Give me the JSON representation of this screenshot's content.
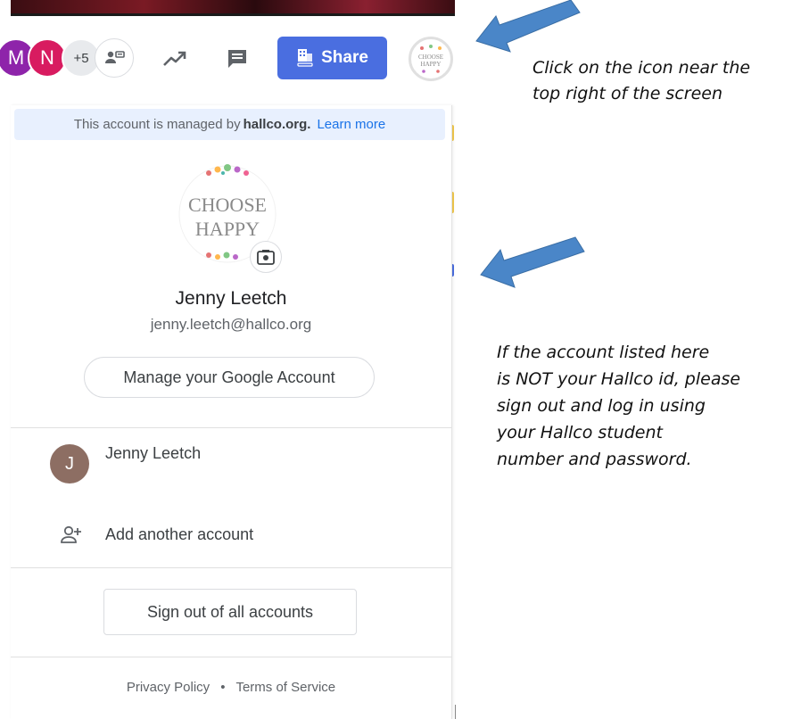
{
  "toolbar": {
    "avatars": [
      {
        "initial": "M",
        "color": "#8e24aa"
      },
      {
        "initial": "N",
        "color": "#d81b60"
      }
    ],
    "more_count": "+5",
    "icons": [
      "present-to-all-icon",
      "trending-up-icon",
      "comment-icon",
      "building-icon"
    ],
    "share_label": "Share",
    "profile_text": [
      "CHOOSE",
      "HAPPY"
    ]
  },
  "panel": {
    "managed_prefix": "This account is managed by",
    "managed_domain": "hallco.org.",
    "learn_more": "Learn more",
    "avatar_text": [
      "CHOOSE",
      "HAPPY"
    ],
    "user_name": "Jenny Leetch",
    "user_email": "jenny.leetch@hallco.org",
    "manage_account": "Manage your Google Account",
    "accounts": [
      {
        "initial": "J",
        "name": "Jenny Leetch",
        "color": "#8d6e63"
      }
    ],
    "add_account": "Add another account",
    "sign_out": "Sign out of all accounts",
    "footer": {
      "privacy": "Privacy Policy",
      "separator": "•",
      "terms": "Terms of Service"
    }
  },
  "annotations": {
    "note1_lines": [
      "Click on the icon near the",
      "top right of the screen"
    ],
    "note2_lines": [
      "If the account listed here",
      "is NOT your Hallco id, please",
      "sign out and log in using",
      "your Hallco student",
      "number and password."
    ],
    "arrow_color": "#4a86c8"
  }
}
